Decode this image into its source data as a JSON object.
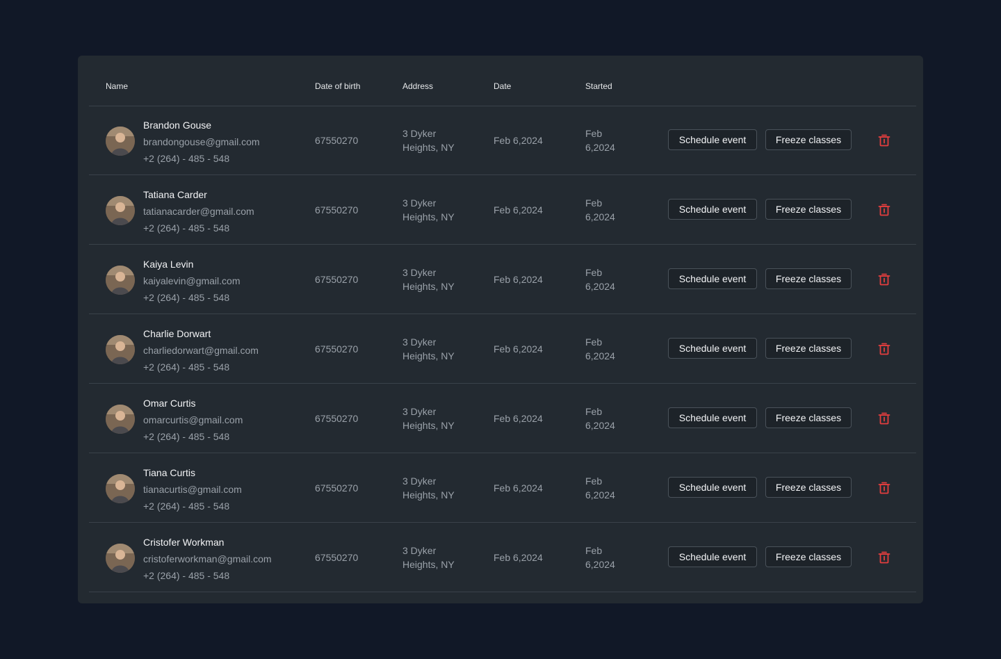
{
  "colors": {
    "background": "#111827",
    "panel": "#232a31",
    "divider": "#3a424a",
    "delete_accent": "#e53e3e"
  },
  "columns": {
    "name": "Name",
    "dob": "Date of birth",
    "address": "Address",
    "date": "Date",
    "started": "Started"
  },
  "actions": {
    "schedule_label": "Schedule event",
    "freeze_label": "Freeze classes",
    "delete_icon": "trash-icon"
  },
  "rows": [
    {
      "name": "Brandon Gouse",
      "email": "brandongouse@gmail.com",
      "phone": "+2 (264) - 485 - 548",
      "dob": "67550270",
      "address_line1": "3 Dyker",
      "address_line2": "Heights, NY",
      "date": "Feb 6,2024",
      "started_line1": "Feb",
      "started_line2": "6,2024"
    },
    {
      "name": "Tatiana Carder",
      "email": "tatianacarder@gmail.com",
      "phone": "+2 (264) - 485 - 548",
      "dob": "67550270",
      "address_line1": "3 Dyker",
      "address_line2": "Heights, NY",
      "date": "Feb 6,2024",
      "started_line1": "Feb",
      "started_line2": "6,2024"
    },
    {
      "name": "Kaiya Levin",
      "email": "kaiyalevin@gmail.com",
      "phone": "+2 (264) - 485 - 548",
      "dob": "67550270",
      "address_line1": "3 Dyker",
      "address_line2": "Heights, NY",
      "date": "Feb 6,2024",
      "started_line1": "Feb",
      "started_line2": "6,2024"
    },
    {
      "name": "Charlie Dorwart",
      "email": "charliedorwart@gmail.com",
      "phone": "+2 (264) - 485 - 548",
      "dob": "67550270",
      "address_line1": "3 Dyker",
      "address_line2": "Heights, NY",
      "date": "Feb 6,2024",
      "started_line1": "Feb",
      "started_line2": "6,2024"
    },
    {
      "name": "Omar Curtis",
      "email": "omarcurtis@gmail.com",
      "phone": "+2 (264) - 485 - 548",
      "dob": "67550270",
      "address_line1": "3 Dyker",
      "address_line2": "Heights, NY",
      "date": "Feb 6,2024",
      "started_line1": "Feb",
      "started_line2": "6,2024"
    },
    {
      "name": "Tiana Curtis",
      "email": "tianacurtis@gmail.com",
      "phone": "+2 (264) - 485 - 548",
      "dob": "67550270",
      "address_line1": "3 Dyker",
      "address_line2": "Heights, NY",
      "date": "Feb 6,2024",
      "started_line1": "Feb",
      "started_line2": "6,2024"
    },
    {
      "name": "Cristofer Workman",
      "email": "cristoferworkman@gmail.com",
      "phone": "+2 (264) - 485 - 548",
      "dob": "67550270",
      "address_line1": "3 Dyker",
      "address_line2": "Heights, NY",
      "date": "Feb 6,2024",
      "started_line1": "Feb",
      "started_line2": "6,2024"
    }
  ]
}
